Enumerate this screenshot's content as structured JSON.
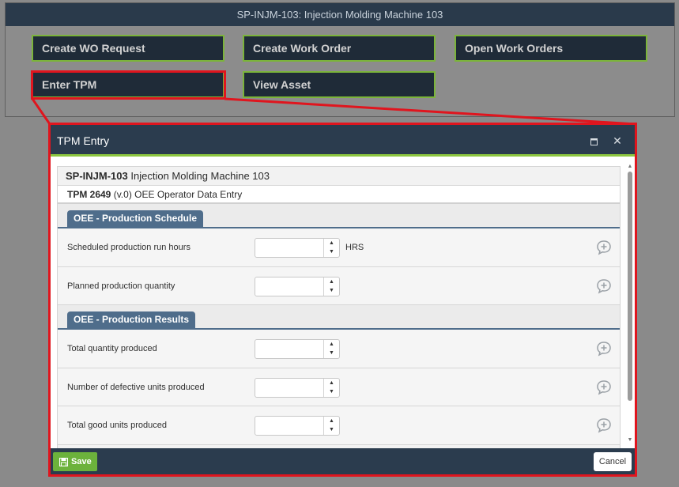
{
  "asset_panel": {
    "title": "SP-INJM-103: Injection Molding Machine 103",
    "buttons": [
      {
        "label": "Create WO Request"
      },
      {
        "label": "Create Work Order"
      },
      {
        "label": "Open Work Orders"
      },
      {
        "label": "Enter TPM"
      },
      {
        "label": "View Asset"
      }
    ]
  },
  "modal": {
    "title": "TPM Entry",
    "asset_code": "SP-INJM-103",
    "asset_name": "Injection Molding Machine 103",
    "tpm_code": "TPM 2649",
    "tpm_version": "(v.0)",
    "tpm_name": "OEE Operator Data Entry",
    "sections": [
      {
        "title": "OEE - Production Schedule",
        "rows": [
          {
            "label": "Scheduled production run hours",
            "value": "",
            "unit": "HRS"
          },
          {
            "label": "Planned production quantity",
            "value": "",
            "unit": ""
          }
        ]
      },
      {
        "title": "OEE - Production Results",
        "rows": [
          {
            "label": "Total quantity produced",
            "value": "",
            "unit": ""
          },
          {
            "label": "Number of defective units produced",
            "value": "",
            "unit": ""
          },
          {
            "label": "Total good units produced",
            "value": "",
            "unit": ""
          }
        ]
      }
    ],
    "footer": {
      "save_label": "Save",
      "cancel_label": "Cancel"
    }
  },
  "icons": {
    "maximize": "maximize-icon",
    "close": "close-icon",
    "save": "floppy-disk-icon",
    "comment": "comment-plus-icon"
  },
  "colors": {
    "highlight": "#e0151e",
    "accent_green": "#7bb43a",
    "header_navy": "#2b3c4e",
    "section_blue": "#4f6d8b"
  }
}
